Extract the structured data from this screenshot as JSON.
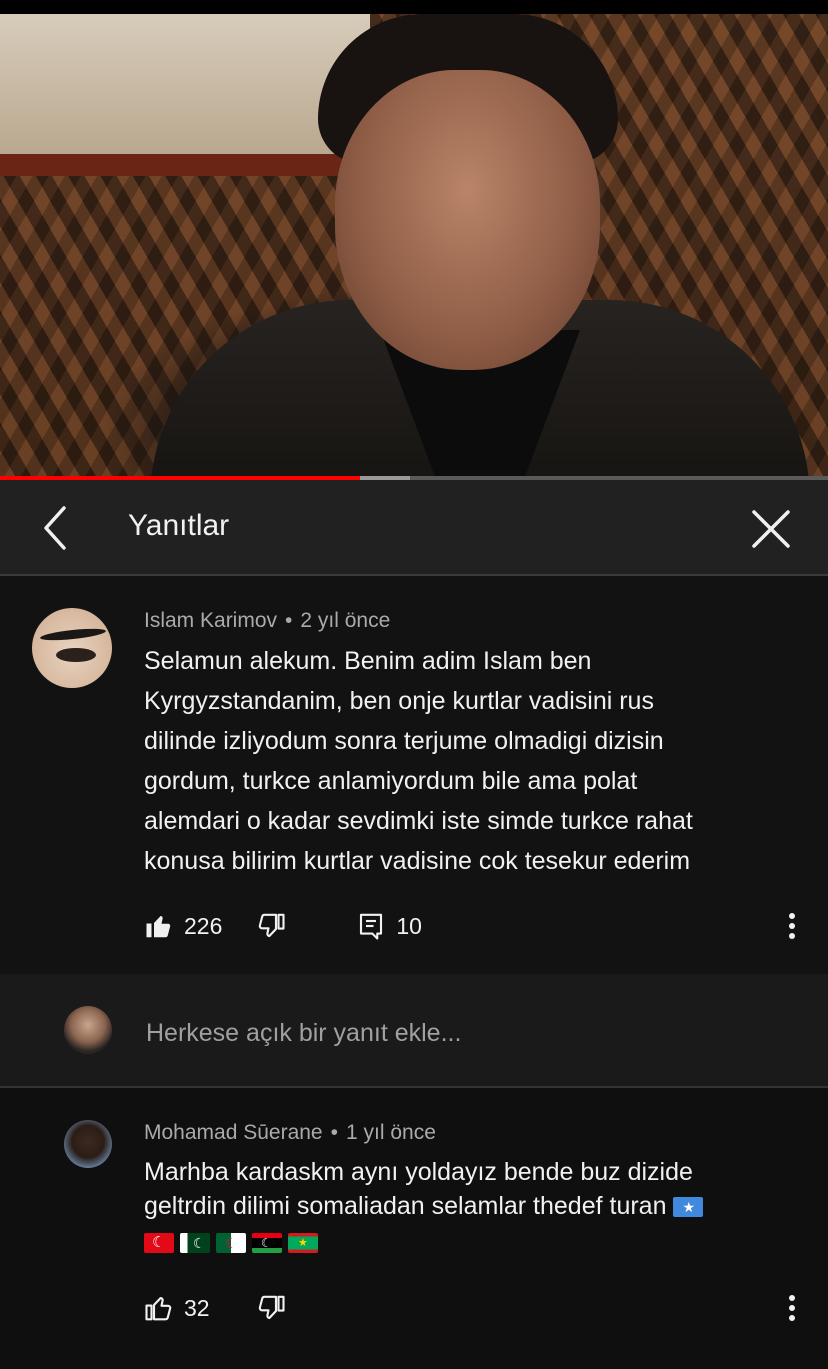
{
  "video": {
    "progress_played": 0.435,
    "progress_buffered": 0.495,
    "colors": {
      "played": "#ff0000",
      "buffered": "#9a9a9a",
      "track": "#5a5a5a"
    }
  },
  "header": {
    "title": "Yanıtlar",
    "back_icon": "chevron-left-icon",
    "close_icon": "close-icon"
  },
  "main_comment": {
    "author": "Islam Karimov",
    "separator": "•",
    "time": "2 yıl önce",
    "text_lines": [
      "Selamun alekum.  Benim adim Islam ben",
      "Kyrgyzstandanim, ben onje kurtlar vadisini rus",
      "dilinde izliyodum sonra terjume olmadigi dizisin",
      "gordum,  turkce anlamiyordum bile ama polat",
      "alemdari o kadar sevdimki iste simde turkce rahat",
      "konusa bilirim kurtlar vadisine cok tesekur ederim"
    ],
    "likes": "226",
    "replies": "10",
    "like_icon": "thumbs-up-filled-icon",
    "dislike_icon": "thumbs-down-icon",
    "reply_icon": "comment-icon",
    "more_icon": "more-vert-icon"
  },
  "reply_input": {
    "placeholder": "Herkese açık bir yanıt ekle..."
  },
  "reply": {
    "author": "Mohamad Sūerane",
    "separator": "•",
    "time": "1 yıl önce",
    "text_lines": [
      "Marhba kardaskm aynı yoldayız bende buz dizide",
      "geltrdin dilimi somaliadan selamlar thedef turan"
    ],
    "flags": [
      "flag-somalia",
      "flag-turkey",
      "flag-pakistan",
      "flag-algeria",
      "flag-libya",
      "flag-mauritania"
    ],
    "likes": "32",
    "like_icon": "thumbs-up-icon",
    "dislike_icon": "thumbs-down-icon",
    "more_icon": "more-vert-icon"
  }
}
